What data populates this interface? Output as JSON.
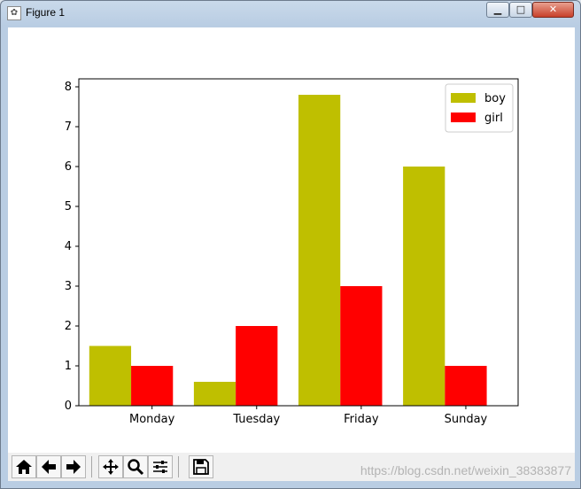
{
  "window": {
    "title": "Figure 1",
    "minimize_glyph": "▁",
    "maximize_glyph": "□",
    "close_glyph": "✕"
  },
  "chart_data": {
    "type": "bar",
    "categories": [
      "Monday",
      "Tuesday",
      "Friday",
      "Sunday"
    ],
    "series": [
      {
        "name": "boy",
        "color": "#bfbf00",
        "values": [
          1.5,
          0.6,
          7.8,
          6.0
        ]
      },
      {
        "name": "girl",
        "color": "#ff0000",
        "values": [
          1.0,
          2.0,
          3.0,
          1.0
        ]
      }
    ],
    "ylim": [
      0,
      8.2
    ],
    "yticks": [
      0,
      1,
      2,
      3,
      4,
      5,
      6,
      7,
      8
    ],
    "grid": false,
    "legend": "top-right"
  },
  "toolbar": {
    "buttons": [
      {
        "name": "home-button",
        "icon": "home-icon"
      },
      {
        "name": "back-button",
        "icon": "arrow-left-icon"
      },
      {
        "name": "forward-button",
        "icon": "arrow-right-icon"
      },
      {
        "name": "pan-button",
        "icon": "move-icon"
      },
      {
        "name": "zoom-button",
        "icon": "magnifier-icon"
      },
      {
        "name": "configure-subplots-button",
        "icon": "sliders-icon"
      },
      {
        "name": "save-button",
        "icon": "floppy-disk-icon"
      }
    ]
  },
  "watermark": "https://blog.csdn.net/weixin_38383877"
}
